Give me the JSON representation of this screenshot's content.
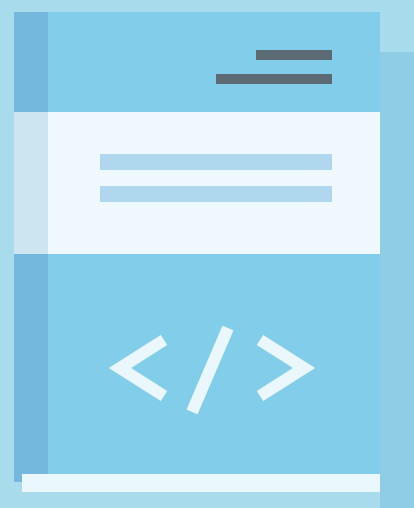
{
  "icon": {
    "name": "code-book-icon",
    "symbol": "</>",
    "colors": {
      "background": "#a8dcec",
      "cover": "#82cdea",
      "spine": "#75b8de",
      "label": "#eff9fd",
      "label_lines": "#afd7ee",
      "dark_lines": "#5b6a73",
      "code_symbol": "#eaf7fc"
    }
  }
}
